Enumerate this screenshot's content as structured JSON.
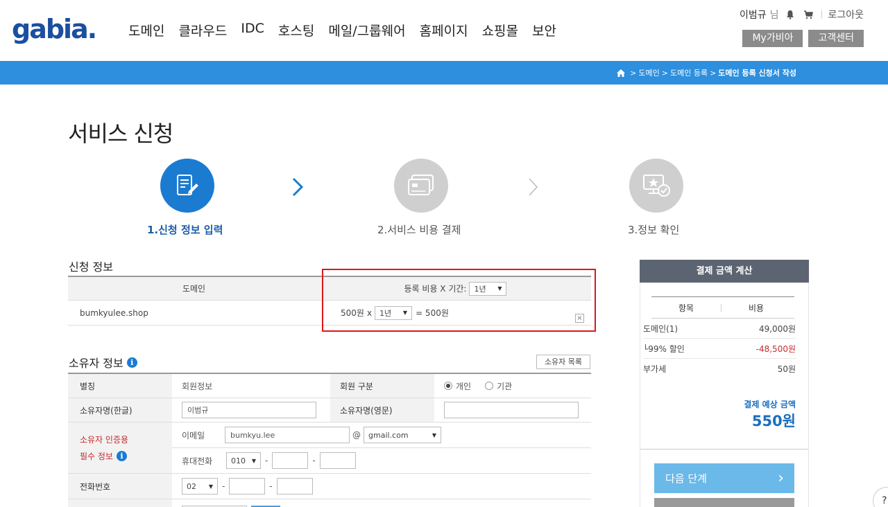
{
  "header": {
    "logo": "gabia.",
    "gnb": [
      "도메인",
      "클라우드",
      "IDC",
      "호스팅",
      "메일/그룹웨어",
      "홈페이지",
      "쇼핑몰",
      "보안"
    ],
    "user_name": "이범규",
    "user_suffix": "님",
    "logout": "로그아웃",
    "my_gabia": "My가비아",
    "customer_center": "고객센터"
  },
  "breadcrumb": {
    "items": [
      "도메인",
      "도메인 등록"
    ],
    "current": "도메인 등록 신청서 작성"
  },
  "page_title": "서비스 신청",
  "steps": [
    {
      "label": "1.신청 정보 입력",
      "active": true
    },
    {
      "label": "2.서비스 비용 결제",
      "active": false
    },
    {
      "label": "3.정보 확인",
      "active": false
    }
  ],
  "application": {
    "section_title": "신청 정보",
    "col_domain": "도메인",
    "col_fee": "등록 비용 X 기간:",
    "period_header": "1년",
    "rows": [
      {
        "domain": "bumkyulee.shop",
        "price": "500원",
        "times": "x",
        "period": "1년",
        "result": "= 500원",
        "delete": "×"
      }
    ]
  },
  "owner": {
    "section_title": "소유자 정보",
    "list_button": "소유자 목록",
    "alias_label": "별칭",
    "alias_value": "회원정보",
    "member_type_label": "회원 구분",
    "member_type_options": [
      "개인",
      "기관"
    ],
    "member_type_selected": "개인",
    "name_ko_label": "소유자명(한글)",
    "name_ko_value": "이범규",
    "name_en_label": "소유자명(영문)",
    "name_en_value": "",
    "auth_label_1": "소유자 인증용",
    "auth_label_2": "필수 정보",
    "email_label": "이메일",
    "email_id": "bumkyu.lee",
    "email_at": "@",
    "email_domain": "gmail.com",
    "mobile_label": "휴대전화",
    "mobile_prefix": "010",
    "phone_label": "전화번호",
    "phone_prefix": "02",
    "dash": "-"
  },
  "summary": {
    "title": "결제 금액 계산",
    "col_item": "항목",
    "col_cost": "비용",
    "rows": [
      {
        "item": "도메인(1)",
        "cost": "49,000원",
        "red": false
      },
      {
        "item": "└99% 할인",
        "cost": "-48,500원",
        "red": true
      },
      {
        "item": "부가세",
        "cost": "50원",
        "red": false
      }
    ],
    "total_label": "결제 예상 금액",
    "total_value": "550원",
    "next_button": "다음 단계",
    "next_arrow": "›"
  },
  "help": "?",
  "colors": {
    "brand_blue": "#2d8fdd",
    "step_active": "#1b7bd1",
    "highlight_red": "#e01515",
    "next_button": "#6bb9e9"
  }
}
